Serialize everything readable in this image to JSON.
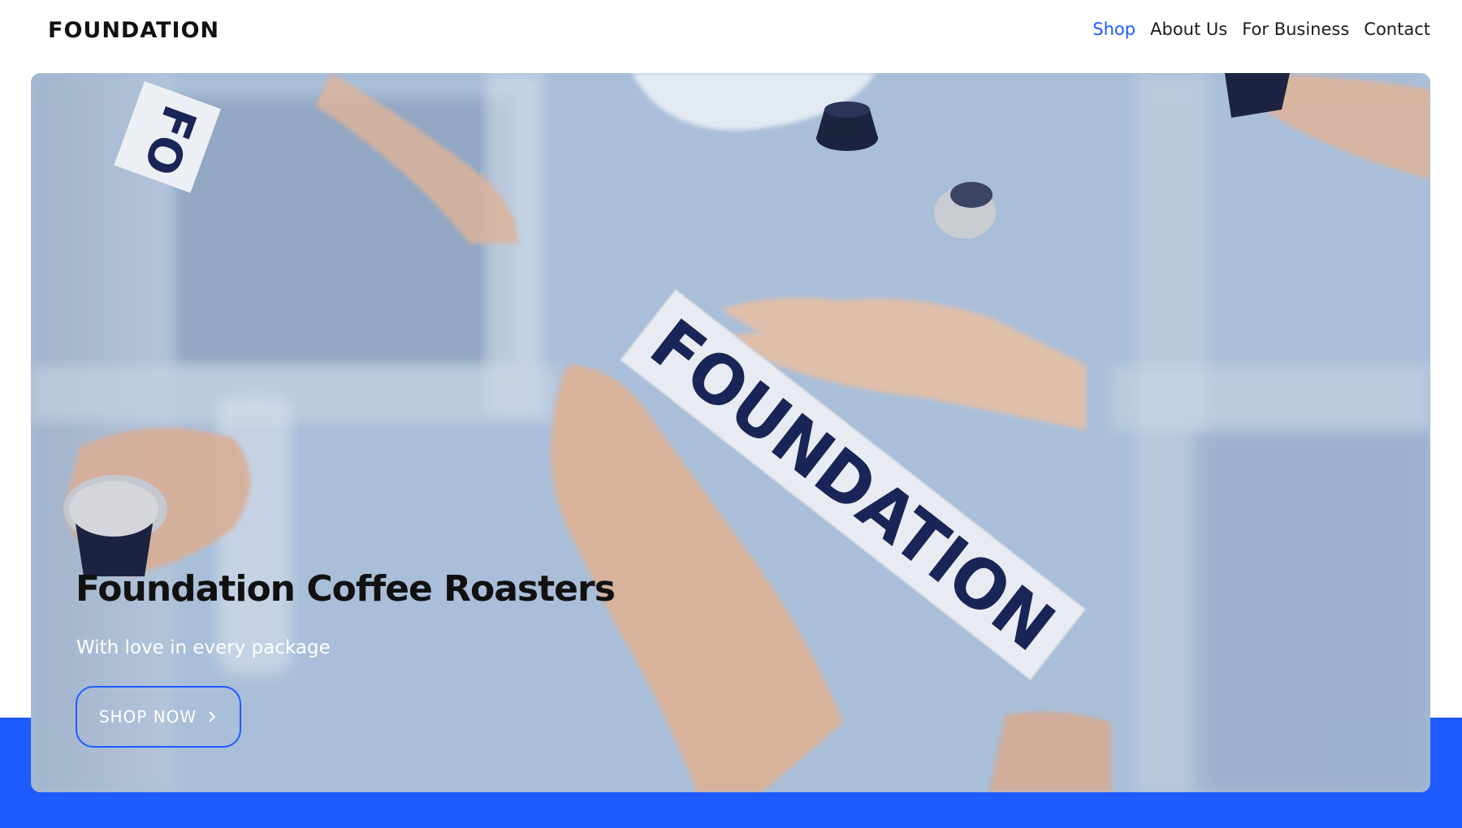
{
  "brand": {
    "logo": "FOUNDATION"
  },
  "nav": {
    "items": [
      {
        "label": "Shop",
        "active": true
      },
      {
        "label": "About Us",
        "active": false
      },
      {
        "label": "For Business",
        "active": false
      },
      {
        "label": "Contact",
        "active": false
      }
    ]
  },
  "hero": {
    "title": "Foundation Coffee Roasters",
    "subtitle": "With love in every package",
    "cta_label": "SHOP NOW",
    "cta_icon": "chevron-right-icon",
    "box_text": "FOUNDATION",
    "box_text_top": "FO"
  },
  "colors": {
    "accent": "#1e5cff",
    "text": "#111111",
    "hero_bg": "#a9bfdb"
  }
}
